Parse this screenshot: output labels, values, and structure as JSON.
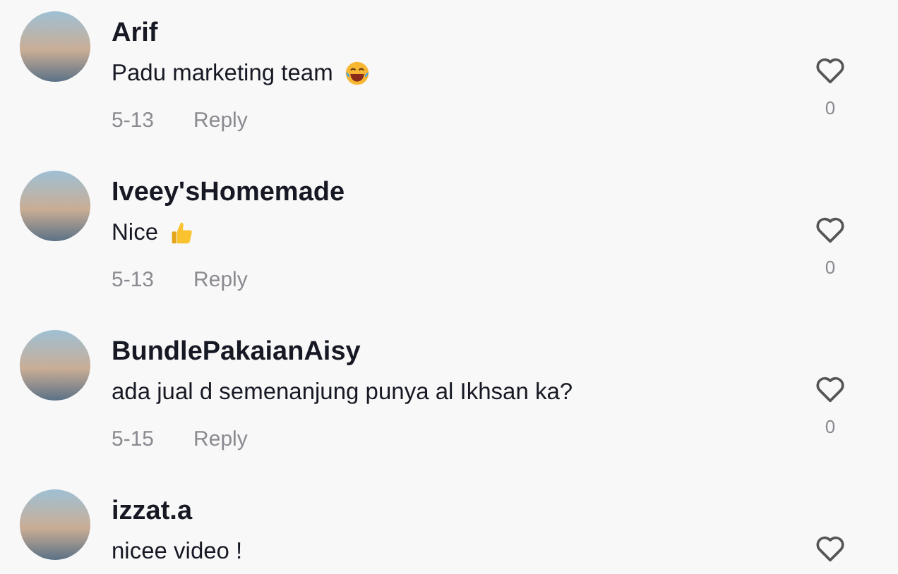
{
  "comments": [
    {
      "username": "Arif",
      "text": "Padu marketing team",
      "kind": "laugh",
      "date": "5-13",
      "reply": "Reply",
      "likes": "0"
    },
    {
      "username": "Iveey'sHomemade",
      "text": "Nice",
      "kind": "thumbsup",
      "date": "5-13",
      "reply": "Reply",
      "likes": "0"
    },
    {
      "username": "BundlePakaianAisy",
      "text": "ada jual d semenanjung punya al Ikhsan ka?",
      "kind": "plain",
      "date": "5-15",
      "reply": "Reply",
      "likes": "0"
    },
    {
      "username": "izzat.a",
      "text": "nicee video !",
      "kind": "plain"
    }
  ]
}
